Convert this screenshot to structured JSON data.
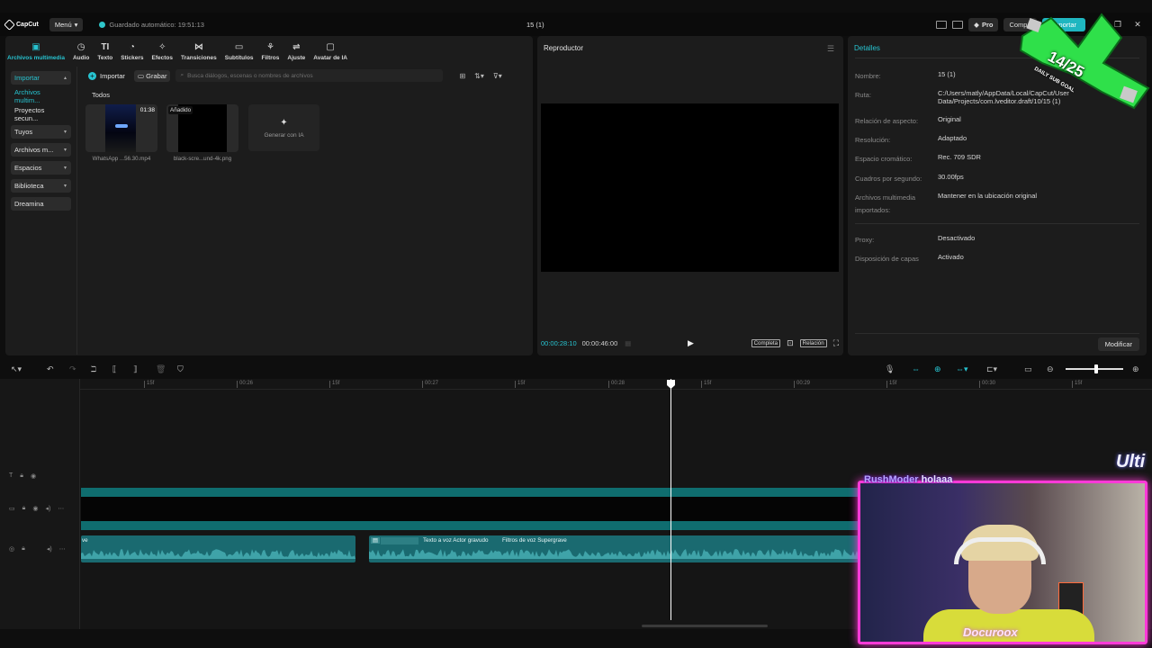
{
  "titlebar": {
    "app_name": "CapCut",
    "menu_label": "Menú",
    "autosave_text": "Guardado automático: 19:51:13",
    "project_title": "15 (1)",
    "pro_label": "Pro",
    "share_label": "Compa",
    "export_label": "Exportar"
  },
  "tool_tabs": [
    {
      "label": "Archivos multimedia",
      "icon": "media-icon"
    },
    {
      "label": "Audio",
      "icon": "audio-icon"
    },
    {
      "label": "Texto",
      "icon": "text-icon"
    },
    {
      "label": "Stickers",
      "icon": "sticker-icon"
    },
    {
      "label": "Efectos",
      "icon": "effects-icon"
    },
    {
      "label": "Transiciones",
      "icon": "transitions-icon"
    },
    {
      "label": "Subtítulos",
      "icon": "subtitles-icon"
    },
    {
      "label": "Filtros",
      "icon": "filters-icon"
    },
    {
      "label": "Ajuste",
      "icon": "adjust-icon"
    },
    {
      "label": "Avatar de IA",
      "icon": "avatar-icon"
    }
  ],
  "side_nav": [
    {
      "label": "Importar"
    },
    {
      "label": "Archivos multim..."
    },
    {
      "label": "Proyectos secun..."
    },
    {
      "label": "Tuyos"
    },
    {
      "label": "Archivos m..."
    },
    {
      "label": "Espacios"
    },
    {
      "label": "Biblioteca"
    },
    {
      "label": "Dreamina"
    }
  ],
  "media": {
    "import_label": "Importar",
    "record_label": "Grabar",
    "search_placeholder": "Busca diálogos, escenas o nombres de archivos",
    "section_label": "Todos",
    "items": [
      {
        "name": "WhatsApp ...56.30.mp4",
        "duration": "01:38"
      },
      {
        "name": "black-scre...und-4k.png",
        "badge": "Añadido"
      }
    ],
    "generate_ai_label": "Generar con IA"
  },
  "player": {
    "title": "Reproductor",
    "current_time": "00:00:28:10",
    "total_time": "00:00:46:00",
    "full_label": "Completa",
    "ratio_label": "Relación"
  },
  "details": {
    "title": "Detalles",
    "rows": [
      {
        "key": "Nombre:",
        "value": "15 (1)"
      },
      {
        "key": "Ruta:",
        "value": "C:/Users/matly/AppData/Local/CapCut/User Data/Projects/com.lveditor.draft/10/15 (1)"
      },
      {
        "key": "Relación de aspecto:",
        "value": "Original"
      },
      {
        "key": "Resolución:",
        "value": "Adaptado"
      },
      {
        "key": "Espacio cromático:",
        "value": "Rec. 709 SDR"
      },
      {
        "key": "Cuadros por segundo:",
        "value": "30.00fps"
      },
      {
        "key": "Archivos multimedia importados:",
        "value": "Mantener en la ubicación original"
      },
      {
        "key": "Proxy:",
        "value": "Desactivado"
      },
      {
        "key": "Disposición de capas",
        "value": "Activado"
      }
    ],
    "modify_label": "Modificar"
  },
  "ruler_ticks": [
    "15f",
    "00:26",
    "15f",
    "00:27",
    "15f",
    "00:28",
    "15f",
    "00:29",
    "15f",
    "00:30",
    "15f"
  ],
  "audio_clips": [
    {
      "label": "ve"
    },
    {
      "label": "Texto a voz Actor gravudo",
      "effect": "Filtros de voz Supergrave"
    }
  ],
  "timeline": {
    "zoom_level": 0.53
  },
  "stream": {
    "chat_user": "RushModer",
    "chat_message": "holaaa",
    "banner": "Ulti",
    "goal_count": "14/25",
    "goal_label": "DAILY SUB GOAL",
    "cam_tag": "Docuroox"
  },
  "colors": {
    "accent": "#27c3d0",
    "overlay_border": "#ff3ad8",
    "goal_green": "#2fe04a"
  }
}
